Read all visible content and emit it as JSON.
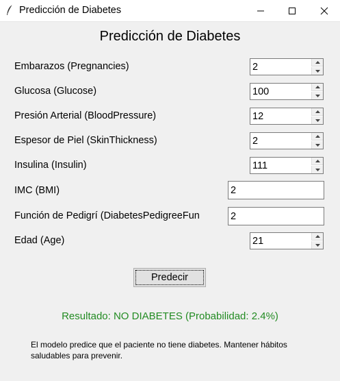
{
  "window": {
    "title": "Predicción de Diabetes",
    "icon": "feather-icon"
  },
  "heading": "Predicción de Diabetes",
  "fields": [
    {
      "label": "Embarazos (Pregnancies)",
      "value": "2",
      "kind": "spinbox"
    },
    {
      "label": "Glucosa (Glucose)",
      "value": "100",
      "kind": "spinbox"
    },
    {
      "label": "Presión Arterial (BloodPressure)",
      "value": "12",
      "kind": "spinbox"
    },
    {
      "label": "Espesor de Piel (SkinThickness)",
      "value": "2",
      "kind": "spinbox"
    },
    {
      "label": "Insulina (Insulin)",
      "value": "111",
      "kind": "spinbox"
    },
    {
      "label": "IMC (BMI)",
      "value": "2",
      "kind": "entry"
    },
    {
      "label": "Función de Pedigrí (DiabetesPedigreeFunction)",
      "value": "2",
      "kind": "entry"
    },
    {
      "label": "Edad (Age)",
      "value": "21",
      "kind": "spinbox"
    }
  ],
  "predict_button": "Predecir",
  "result": {
    "text": "Resultado: NO DIABETES (Probabilidad: 2.4%)",
    "color": "#228b22"
  },
  "advice": "El modelo predice que el paciente no tiene diabetes. Mantener hábitos saludables para prevenir."
}
